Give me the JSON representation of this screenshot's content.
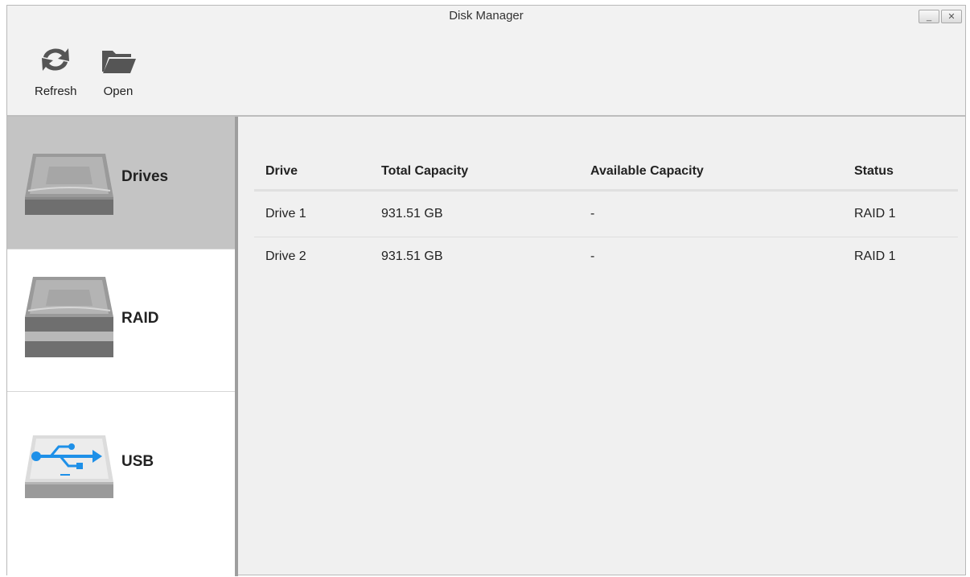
{
  "window": {
    "title": "Disk Manager",
    "minimize_icon": "minimize-icon",
    "close_icon": "close-icon"
  },
  "toolbar": {
    "refresh": {
      "label": "Refresh",
      "icon": "refresh-icon"
    },
    "open": {
      "label": "Open",
      "icon": "folder-icon"
    }
  },
  "sidebar": {
    "items": [
      {
        "label": "Drives",
        "icon": "hard-drive-icon",
        "active": true
      },
      {
        "label": "RAID",
        "icon": "raid-drives-icon",
        "active": false
      },
      {
        "label": "USB",
        "icon": "usb-drive-icon",
        "active": false
      }
    ]
  },
  "table": {
    "headers": [
      "Drive",
      "Total Capacity",
      "Available Capacity",
      "Status"
    ],
    "rows": [
      [
        "Drive 1",
        "931.51 GB",
        "-",
        "RAID 1"
      ],
      [
        "Drive 2",
        "931.51 GB",
        "-",
        "RAID 1"
      ]
    ]
  },
  "colors": {
    "accent_usb": "#1e90e8",
    "sidebar_active": "#c4c4c4",
    "toolbar_icon": "#555555"
  }
}
